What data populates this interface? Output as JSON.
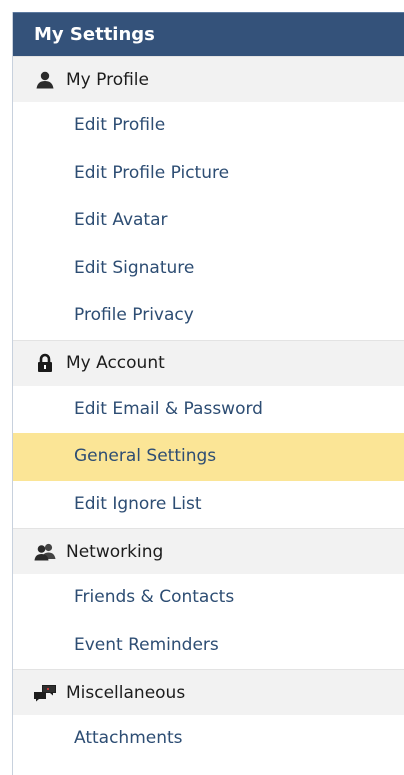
{
  "header": {
    "title": "My Settings"
  },
  "sections": [
    {
      "label": "My Profile",
      "icon": "person-icon",
      "items": [
        {
          "label": "Edit Profile"
        },
        {
          "label": "Edit Profile Picture"
        },
        {
          "label": "Edit Avatar"
        },
        {
          "label": "Edit Signature"
        },
        {
          "label": "Profile Privacy"
        }
      ]
    },
    {
      "label": "My Account",
      "icon": "lock-icon",
      "items": [
        {
          "label": "Edit Email & Password"
        },
        {
          "label": "General Settings",
          "active": true
        },
        {
          "label": "Edit Ignore List"
        }
      ]
    },
    {
      "label": "Networking",
      "icon": "people-icon",
      "items": [
        {
          "label": "Friends & Contacts"
        },
        {
          "label": "Event Reminders"
        }
      ]
    },
    {
      "label": "Miscellaneous",
      "icon": "chat-icon",
      "items": [
        {
          "label": "Attachments"
        }
      ]
    }
  ],
  "colors": {
    "header_bg": "#34527a",
    "active_bg": "#fbe596",
    "link": "#2d4d73",
    "section_bg": "#f2f2f2"
  }
}
